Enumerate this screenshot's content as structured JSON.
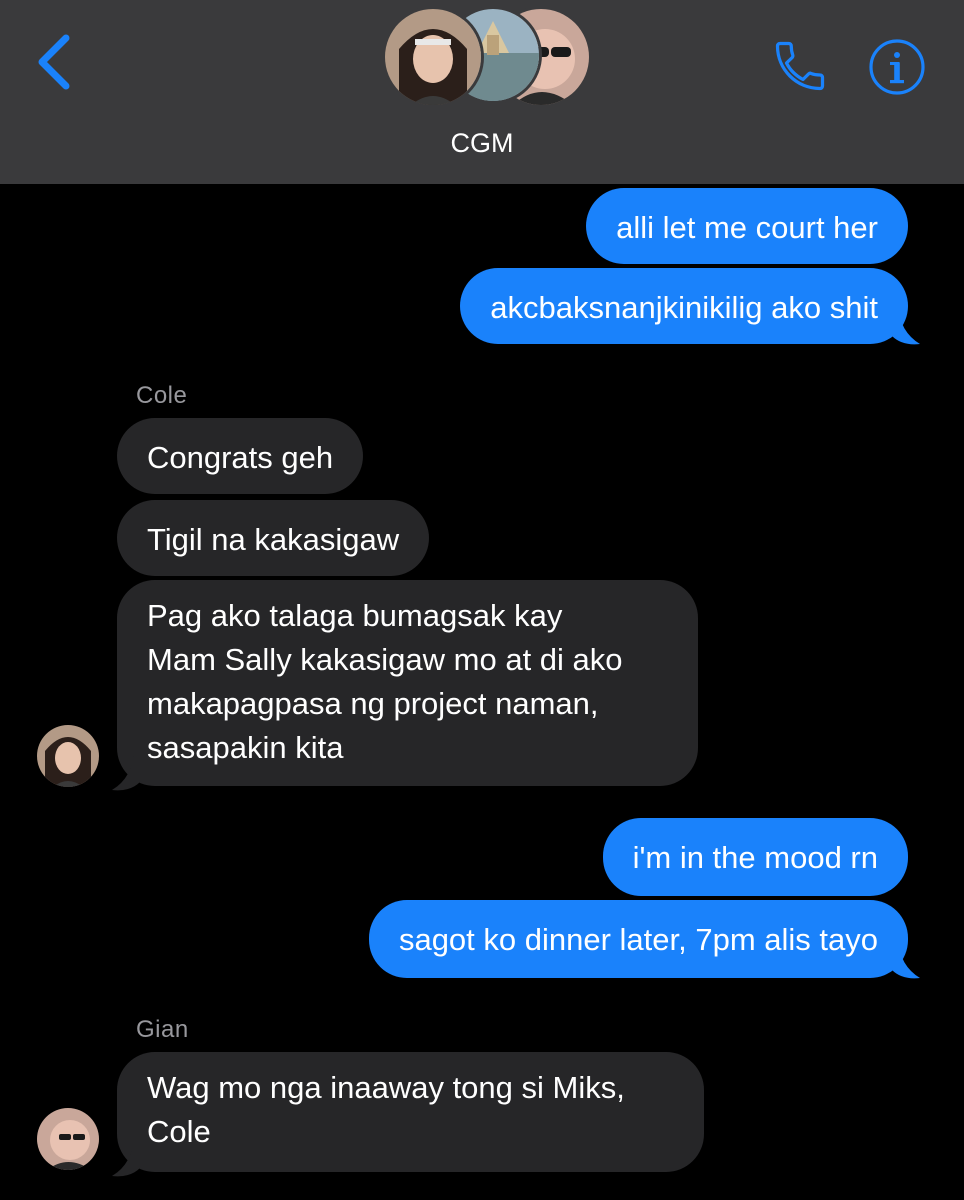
{
  "header": {
    "chat_title": "CGM",
    "back_icon": "chevron-left-icon",
    "call_icon": "phone-icon",
    "info_icon": "info-icon",
    "accent_color": "#1a82fb"
  },
  "messages": [
    {
      "type": "sent",
      "text": "alli let me court her"
    },
    {
      "type": "sent",
      "text": "akcbaksnanjkinikilig ako shit"
    },
    {
      "type": "sender",
      "text": "Cole"
    },
    {
      "type": "received",
      "sender": "Cole",
      "text": "Congrats geh"
    },
    {
      "type": "received",
      "sender": "Cole",
      "text": "Tigil na kakasigaw"
    },
    {
      "type": "received",
      "sender": "Cole",
      "lines": [
        "Pag ako talaga bumagsak kay",
        "Mam Sally kakasigaw mo at di ako",
        "makapagpasa ng project naman,",
        "sasapakin kita"
      ]
    },
    {
      "type": "sent",
      "text": "i'm in the mood rn"
    },
    {
      "type": "sent",
      "text": "sagot ko dinner later, 7pm alis tayo"
    },
    {
      "type": "sender",
      "text": "Gian"
    },
    {
      "type": "received",
      "sender": "Gian",
      "lines": [
        "Wag mo nga inaaway tong si Miks,",
        "Cole"
      ]
    }
  ]
}
